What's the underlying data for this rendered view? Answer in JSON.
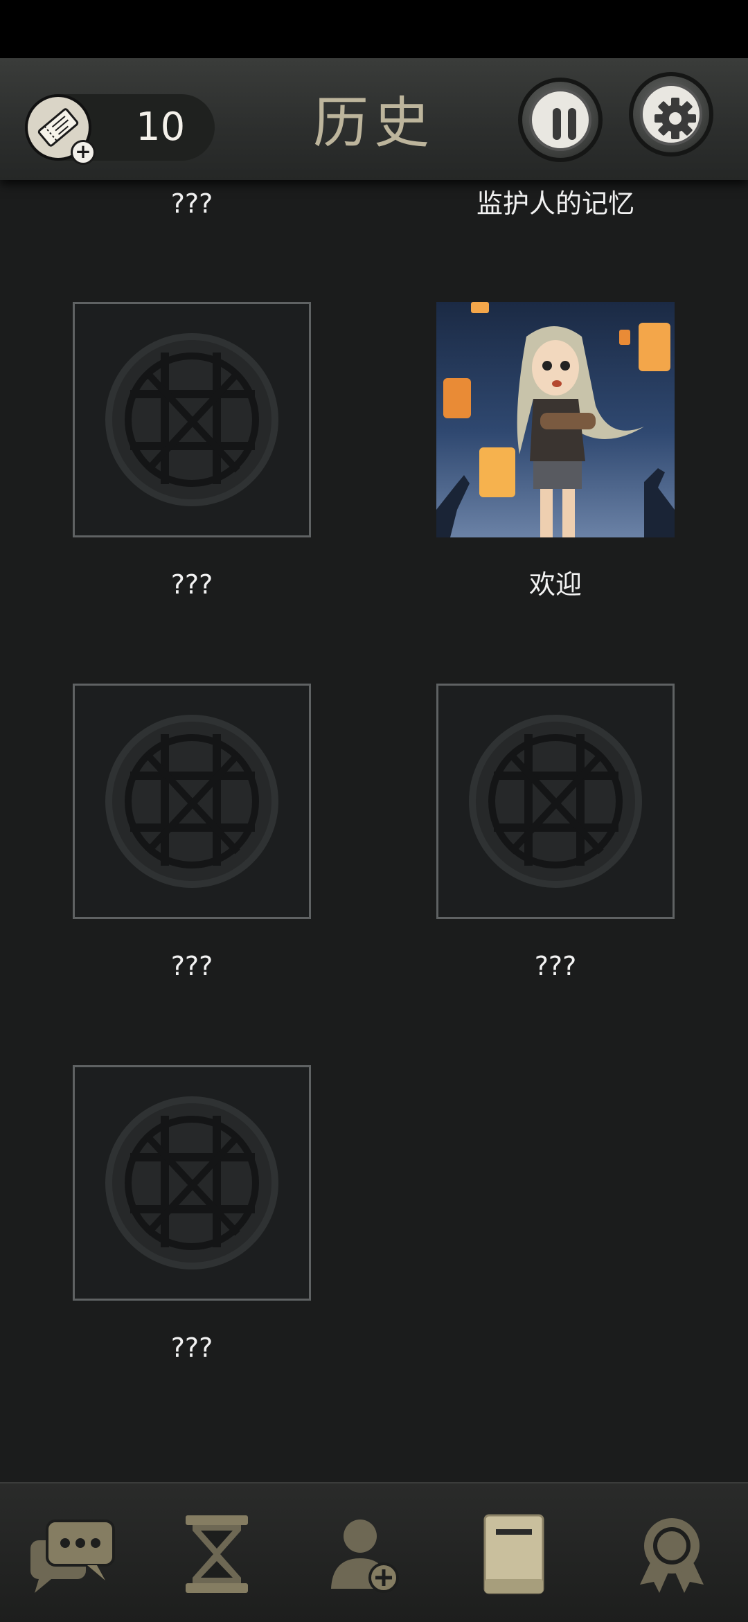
{
  "header": {
    "title": "历史",
    "ticket_count": "10",
    "pause_label": "pause-icon",
    "settings_label": "gear-icon"
  },
  "history": {
    "items": [
      {
        "label": "???",
        "locked": true
      },
      {
        "label": "监护人的记忆",
        "locked": false
      },
      {
        "label": "???",
        "locked": true
      },
      {
        "label": "欢迎",
        "locked": false
      },
      {
        "label": "???",
        "locked": true
      },
      {
        "label": "???",
        "locked": true
      },
      {
        "label": "???",
        "locked": true
      }
    ]
  },
  "bottom_nav": {
    "items": [
      {
        "icon": "chat-icon",
        "active": false
      },
      {
        "icon": "hourglass-icon",
        "active": false
      },
      {
        "icon": "add-user-icon",
        "active": false
      },
      {
        "icon": "book-icon",
        "active": true
      },
      {
        "icon": "award-icon",
        "active": false
      }
    ]
  },
  "colors": {
    "background": "#1b1c1c",
    "title": "#bdb59c",
    "nav_icon": "#716a55",
    "nav_active": "#c9bf9d"
  }
}
